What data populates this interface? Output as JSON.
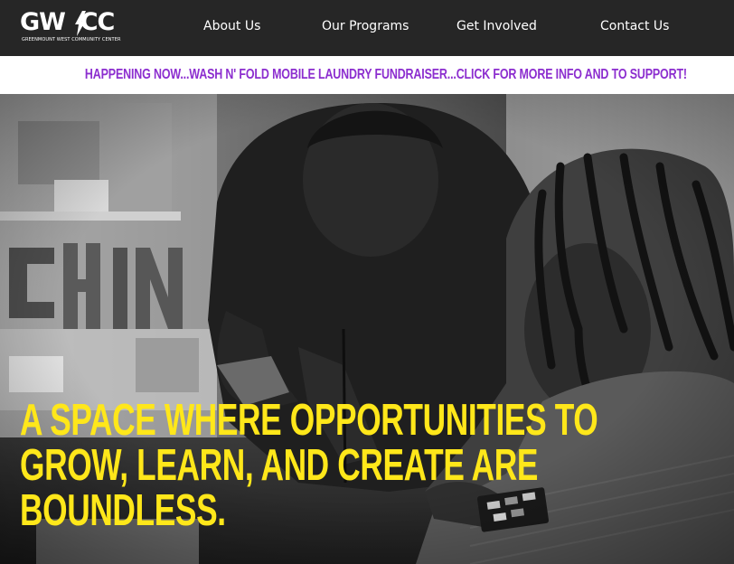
{
  "logo": {
    "mark": "GW/CC",
    "subtitle": "GREENMOUNT WEST COMMUNITY CENTER"
  },
  "nav": {
    "items": [
      {
        "label": "About Us"
      },
      {
        "label": "Our Programs"
      },
      {
        "label": "Get Involved"
      },
      {
        "label": "Contact Us"
      }
    ]
  },
  "announcement": {
    "text": "HAPPENING NOW...WASH N' FOLD MOBILE LAUNDRY FUNDRAISER...CLICK FOR MORE INFO AND TO SUPPORT!",
    "color": "#8c2ecf"
  },
  "hero": {
    "headline_lines": [
      "A SPACE WHERE OPPORTUNITIES TO",
      "GROW, LEARN, AND CREATE ARE",
      "BOUNDLESS."
    ],
    "headline_color": "#ffe71a",
    "photo_description_icon": "hero-photo"
  },
  "colors": {
    "header_bg": "#262626",
    "announce_bg": "#ffffff"
  }
}
